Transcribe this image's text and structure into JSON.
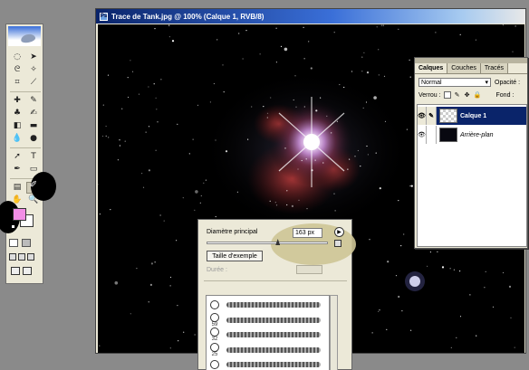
{
  "document": {
    "title": "Trace de Tank.jpg @ 100% (Calque 1, RVB/8)"
  },
  "layers_palette": {
    "tabs": [
      "Calques",
      "Couches",
      "Tracés"
    ],
    "blend_mode": "Normal",
    "opacity_label": "Opacité :",
    "lock_label": "Verrou :",
    "fill_label": "Fond :",
    "layers": [
      {
        "name": "Calque 1",
        "active": true
      },
      {
        "name": "Arrière-plan",
        "active": false
      }
    ]
  },
  "brush_panel": {
    "diameter_label": "Diamètre principal",
    "diameter_value": "163 px",
    "diameter_fraction": 0.58,
    "sample_button": "Taille d'exemple",
    "duration_label": "Durée :",
    "presets": [
      {
        "size": ""
      },
      {
        "size": "59"
      },
      {
        "size": "32"
      },
      {
        "size": "25"
      },
      {
        "size": ""
      }
    ]
  },
  "toolbox": {
    "foreground_color": "#f28ee6",
    "background_color": "#ffffff",
    "tools": [
      "marquee-icon",
      "move-icon",
      "lasso-icon",
      "magic-wand-icon",
      "crop-icon",
      "slice-icon",
      "healing-brush-icon",
      "brush-icon",
      "clone-stamp-icon",
      "history-brush-icon",
      "eraser-icon",
      "gradient-icon",
      "blur-icon",
      "dodge-icon",
      "path-selection-icon",
      "type-icon",
      "pen-icon",
      "shape-icon",
      "notes-icon",
      "eyedropper-icon",
      "hand-icon",
      "zoom-icon"
    ]
  },
  "colors": {
    "title_bar": "#0a246a",
    "palette_bg": "#ece9d8",
    "canvas_bg": "#000000",
    "highlight_tan": "#cec596"
  }
}
